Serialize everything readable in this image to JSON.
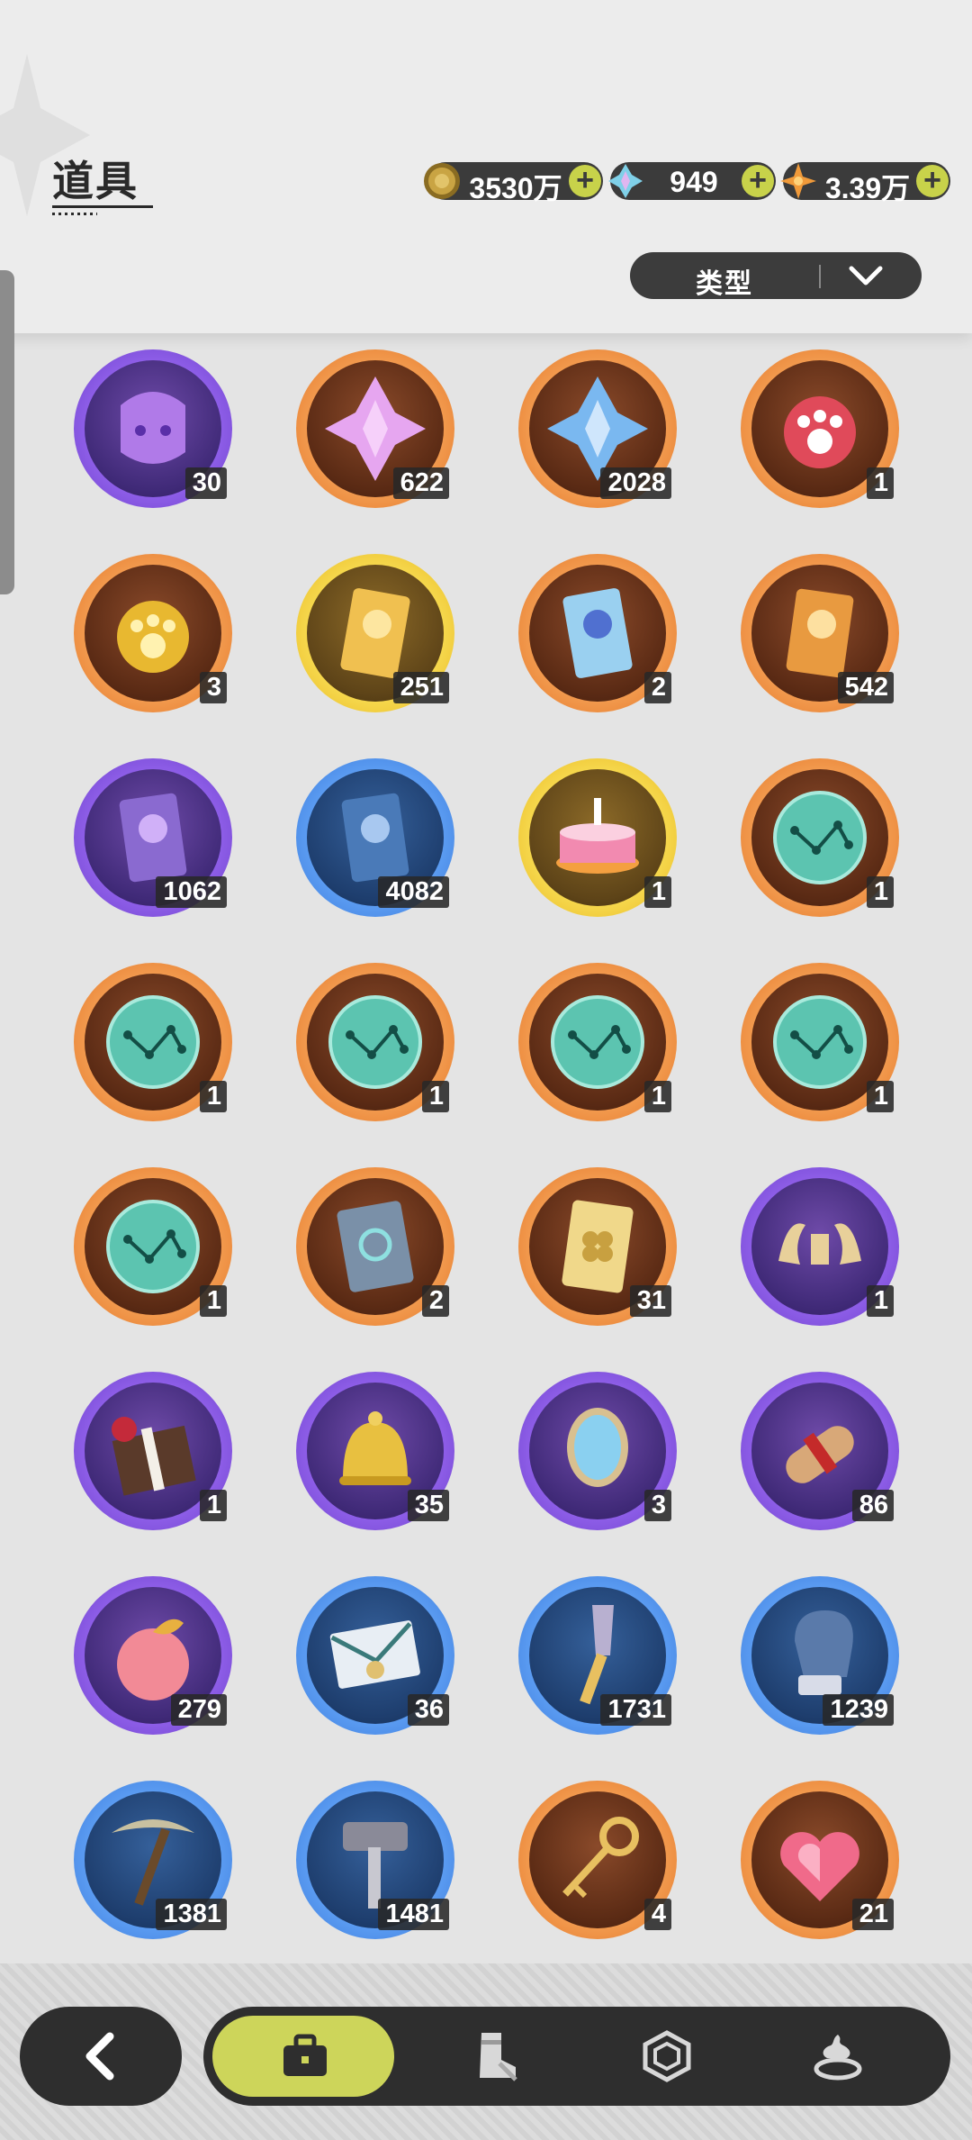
{
  "header": {
    "title": "道具",
    "filter_label": "类型"
  },
  "currencies": [
    {
      "icon": "gold-coin-icon",
      "value": "3530万",
      "color": "#b8953a"
    },
    {
      "icon": "crystal-gem-icon",
      "value": "949",
      "color": "#7fd0e8"
    },
    {
      "icon": "star-shard-icon",
      "value": "3.39万",
      "color": "#f09a3a"
    }
  ],
  "items": [
    {
      "icon": "purple-cat-puzzle-icon",
      "rarity": "purple",
      "count": "30"
    },
    {
      "icon": "pink-crystal-icon",
      "rarity": "orange",
      "count": "622"
    },
    {
      "icon": "blue-crystal-icon",
      "rarity": "orange",
      "count": "2028"
    },
    {
      "icon": "red-paw-pendant-icon",
      "rarity": "orange",
      "count": "1"
    },
    {
      "icon": "gold-paw-pendant-icon",
      "rarity": "orange",
      "count": "3"
    },
    {
      "icon": "gold-character-card-icon",
      "rarity": "gold",
      "count": "251"
    },
    {
      "icon": "rainbow-character-card-icon",
      "rarity": "orange",
      "count": "2"
    },
    {
      "icon": "orange-character-card-icon",
      "rarity": "orange",
      "count": "542"
    },
    {
      "icon": "purple-character-card-icon",
      "rarity": "purple",
      "count": "1062"
    },
    {
      "icon": "blue-character-card-icon",
      "rarity": "blue",
      "count": "4082"
    },
    {
      "icon": "birthday-cake-icon",
      "rarity": "gold",
      "count": "1"
    },
    {
      "icon": "constellation-orb-icon",
      "rarity": "orange",
      "count": "1"
    },
    {
      "icon": "constellation-orb-icon",
      "rarity": "orange",
      "count": "1"
    },
    {
      "icon": "constellation-orb-icon",
      "rarity": "orange",
      "count": "1"
    },
    {
      "icon": "constellation-orb-icon",
      "rarity": "orange",
      "count": "1"
    },
    {
      "icon": "constellation-orb-icon",
      "rarity": "orange",
      "count": "1"
    },
    {
      "icon": "constellation-orb-icon",
      "rarity": "orange",
      "count": "1"
    },
    {
      "icon": "rune-book-icon",
      "rarity": "orange",
      "count": "2"
    },
    {
      "icon": "clover-ticket-icon",
      "rarity": "orange",
      "count": "31"
    },
    {
      "icon": "gold-horns-icon",
      "rarity": "purple",
      "count": "1"
    },
    {
      "icon": "gift-box-icon",
      "rarity": "purple",
      "count": "1"
    },
    {
      "icon": "gold-bell-icon",
      "rarity": "purple",
      "count": "35"
    },
    {
      "icon": "magic-mirror-icon",
      "rarity": "purple",
      "count": "3"
    },
    {
      "icon": "scroll-icon",
      "rarity": "purple",
      "count": "86"
    },
    {
      "icon": "peach-icon",
      "rarity": "purple",
      "count": "279"
    },
    {
      "icon": "envelope-icon",
      "rarity": "blue",
      "count": "36"
    },
    {
      "icon": "shovel-icon",
      "rarity": "blue",
      "count": "1731"
    },
    {
      "icon": "glove-icon",
      "rarity": "blue",
      "count": "1239"
    },
    {
      "icon": "pickaxe-icon",
      "rarity": "blue",
      "count": "1381"
    },
    {
      "icon": "hammer-icon",
      "rarity": "blue",
      "count": "1481"
    },
    {
      "icon": "gold-key-icon",
      "rarity": "orange",
      "count": "4"
    },
    {
      "icon": "ruby-heart-icon",
      "rarity": "orange",
      "count": "21"
    }
  ],
  "nav": [
    {
      "icon": "back-arrow-icon"
    },
    {
      "icon": "briefcase-icon",
      "active": true
    },
    {
      "icon": "boot-icon"
    },
    {
      "icon": "hexagon-gem-icon"
    },
    {
      "icon": "cream-dessert-icon"
    }
  ]
}
